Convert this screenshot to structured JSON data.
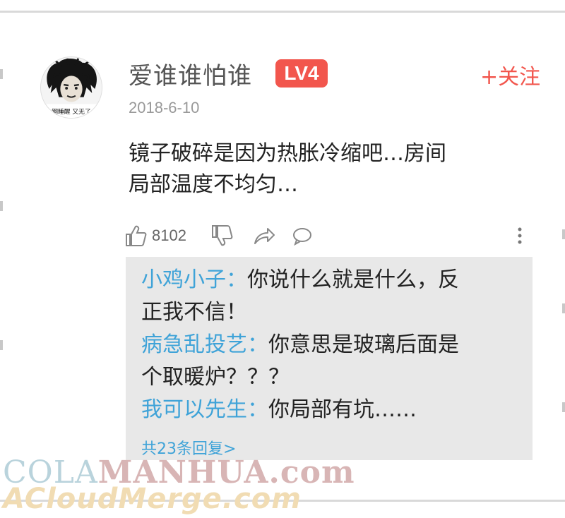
{
  "post": {
    "username": "爱谁谁怕谁",
    "level": "LV4",
    "follow_label": "+关注",
    "date": "2018-6-10",
    "avatar_text": "钢睡醒 又无了",
    "comment_line1": "镜子破碎是因为热胀冷缩吧…房间",
    "comment_line2": "局部温度不均匀…"
  },
  "actions": {
    "like_count": "8102",
    "icons": [
      "thumbs-up-icon",
      "thumbs-down-icon",
      "share-icon",
      "comment-icon",
      "more-icon"
    ]
  },
  "replies": {
    "items": [
      {
        "name": "小鸡小子：",
        "text": "你说什么就是什么，反",
        "cont": "正我不信！"
      },
      {
        "name": "病急乱投艺：",
        "text": "你意思是玻璃后面是",
        "cont": "个取暖炉？？？"
      },
      {
        "name": "我可以先生：",
        "text": "你局部有坑……",
        "cont": ""
      }
    ],
    "more_label": "共23条回复>"
  },
  "watermark": {
    "line1_a": "COLA",
    "line1_b": "MANHUA.com",
    "line2": "ACloudMerge.com"
  },
  "colors": {
    "accent": "#f2564d",
    "reply_name": "#3fa3d8",
    "reply_bg": "#e8e8e8"
  }
}
